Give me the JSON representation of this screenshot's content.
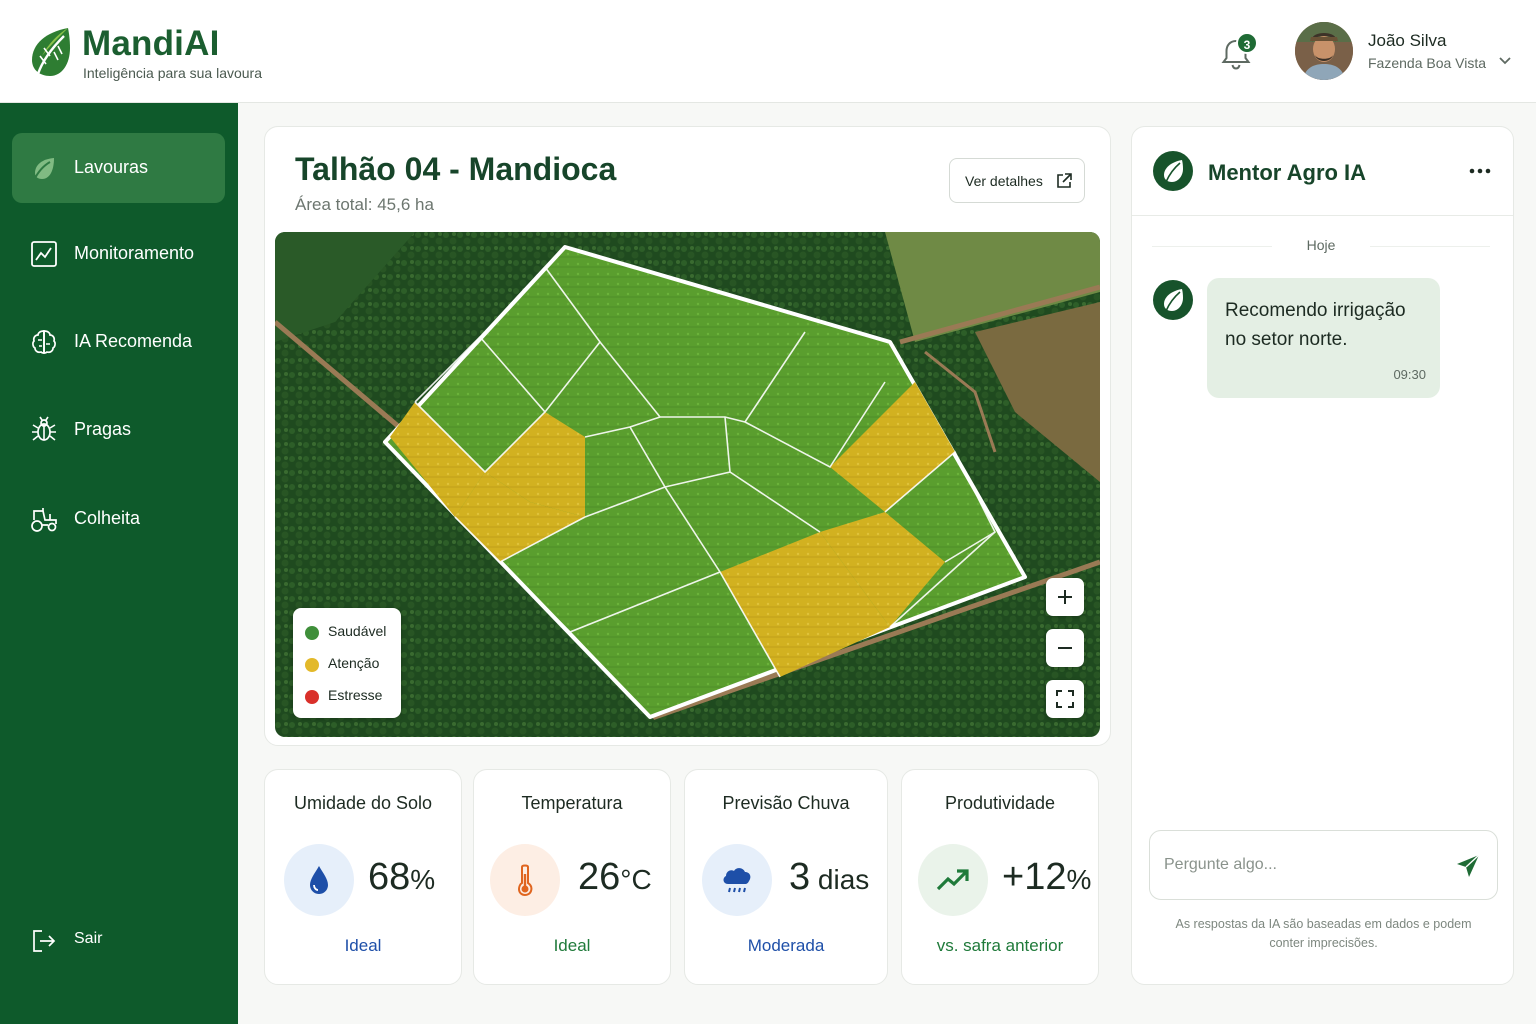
{
  "brand": {
    "name": "MandiAI",
    "tagline": "Inteligência para sua lavoura"
  },
  "header": {
    "notifications_count": "3",
    "user": {
      "name": "João Silva",
      "farm": "Fazenda Boa Vista"
    }
  },
  "sidebar": {
    "items": [
      {
        "label": "Lavouras",
        "icon": "leaf-icon",
        "active": true
      },
      {
        "label": "Monitoramento",
        "icon": "chart-line-icon",
        "active": false
      },
      {
        "label": "IA Recomenda",
        "icon": "brain-icon",
        "active": false
      },
      {
        "label": "Pragas",
        "icon": "bug-icon",
        "active": false
      },
      {
        "label": "Colheita",
        "icon": "tractor-icon",
        "active": false
      }
    ],
    "logout_label": "Sair"
  },
  "field": {
    "title": "Talhão 04 - Mandioca",
    "area": "Área total: 45,6 ha",
    "details_button": "Ver detalhes",
    "legend": [
      {
        "label": "Saudável",
        "color": "#3f8f3a"
      },
      {
        "label": "Atenção",
        "color": "#e3b92a"
      },
      {
        "label": "Estresse",
        "color": "#d9302a"
      }
    ]
  },
  "metrics": [
    {
      "title": "Umidade do Solo",
      "value": "68",
      "unit": "%",
      "status": "Ideal",
      "status_color": "#1e4fa8",
      "icon": "water-drop-icon",
      "icon_bg": "#e6effa"
    },
    {
      "title": "Temperatura",
      "value": "26",
      "unit": "°C",
      "status": "Ideal",
      "status_color": "#1f7a3a",
      "icon": "thermometer-icon",
      "icon_bg": "#fdeee4"
    },
    {
      "title": "Previsão Chuva",
      "value": "3",
      "unit": " dias",
      "status": "Moderada",
      "status_color": "#1e4fa8",
      "icon": "rain-cloud-icon",
      "icon_bg": "#e6effa"
    },
    {
      "title": "Produtividade",
      "value": "+12",
      "unit": "%",
      "status": "vs. safra anterior",
      "status_color": "#1f7a3a",
      "icon": "trend-up-icon",
      "icon_bg": "#eaf3ea"
    }
  ],
  "chat": {
    "title": "Mentor Agro IA",
    "day_label": "Hoje",
    "messages": [
      {
        "text": "Recomendo irrigação no setor norte.",
        "time": "09:30"
      }
    ],
    "input_placeholder": "Pergunte algo...",
    "disclaimer": "As respostas da IA são baseadas em dados e podem conter imprecisões."
  },
  "colors": {
    "primary": "#0e5a2b",
    "accent": "#1b5e30",
    "healthy": "#3f8f3a",
    "warning": "#e3b92a",
    "stress": "#d9302a"
  }
}
